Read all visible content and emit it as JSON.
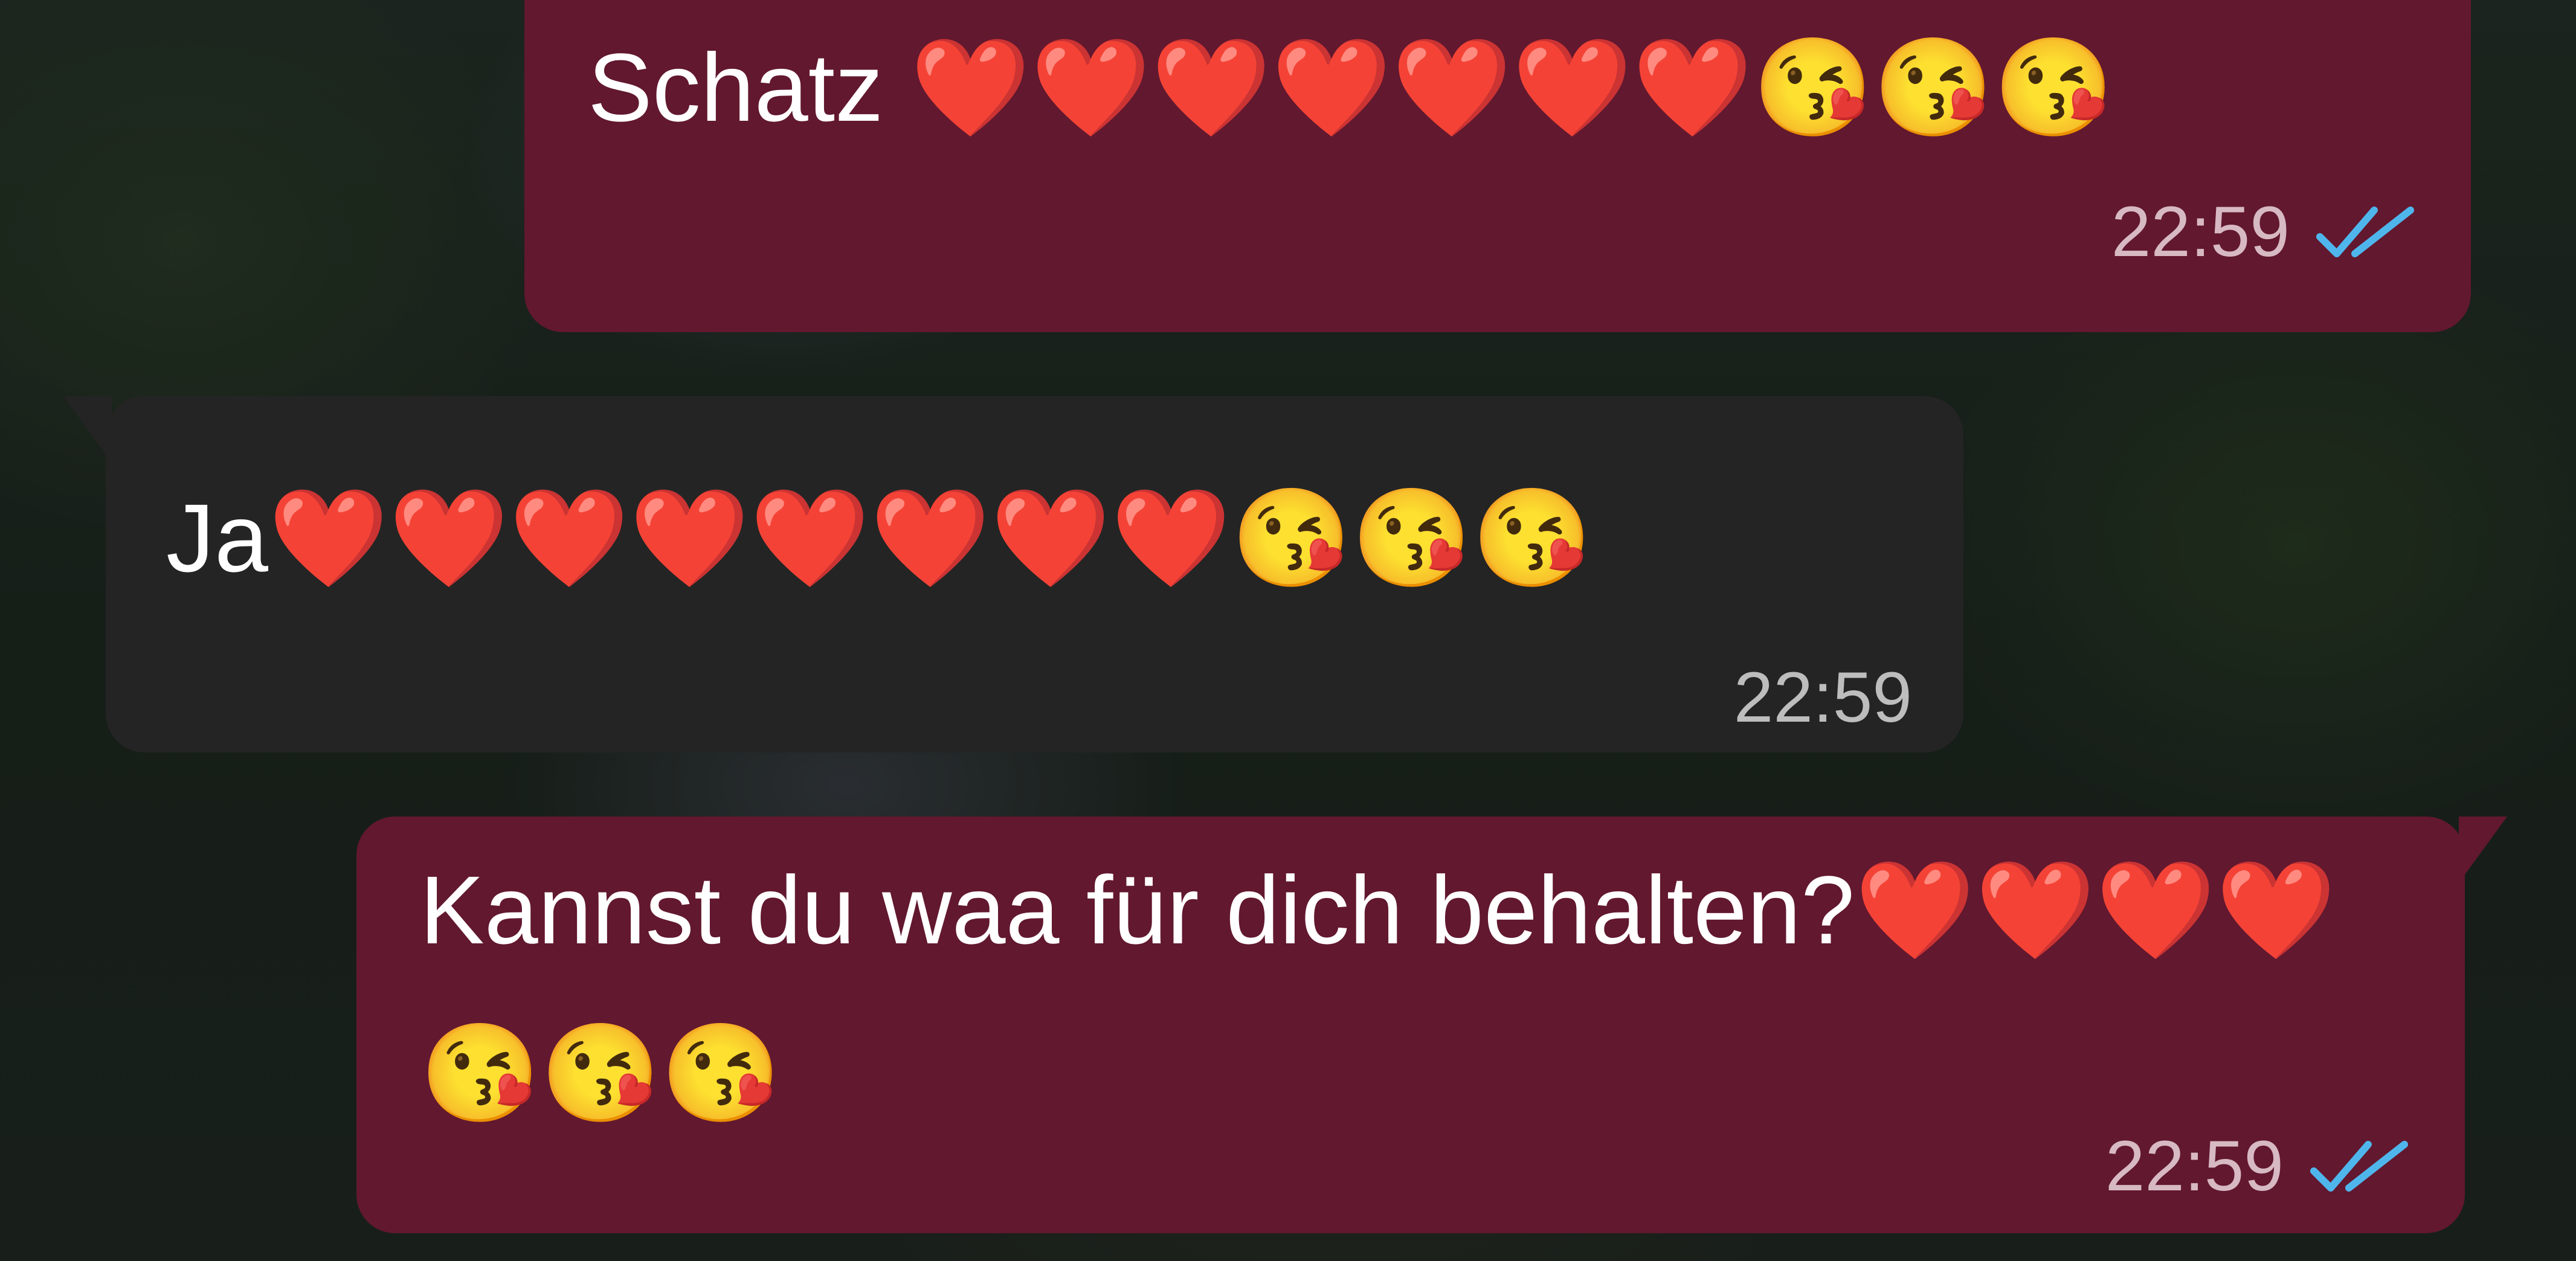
{
  "messages": [
    {
      "direction": "outgoing",
      "text": "Schatz ❤️❤️❤️❤️❤️❤️❤️😘😘😘",
      "time": "22:59",
      "status": "read-double-check-icon"
    },
    {
      "direction": "incoming",
      "text": "Ja❤️❤️❤️❤️❤️❤️❤️❤️😘😘😘",
      "time": "22:59"
    },
    {
      "direction": "outgoing",
      "text": "Kannst du waa für dich behalten?❤️❤️❤️❤️😘😘😘",
      "time": "22:59",
      "status": "read-double-check-icon"
    }
  ],
  "colors": {
    "outgoing_bubble": "#62182f",
    "incoming_bubble": "#242424",
    "read_ticks": "#4fb6ec"
  }
}
